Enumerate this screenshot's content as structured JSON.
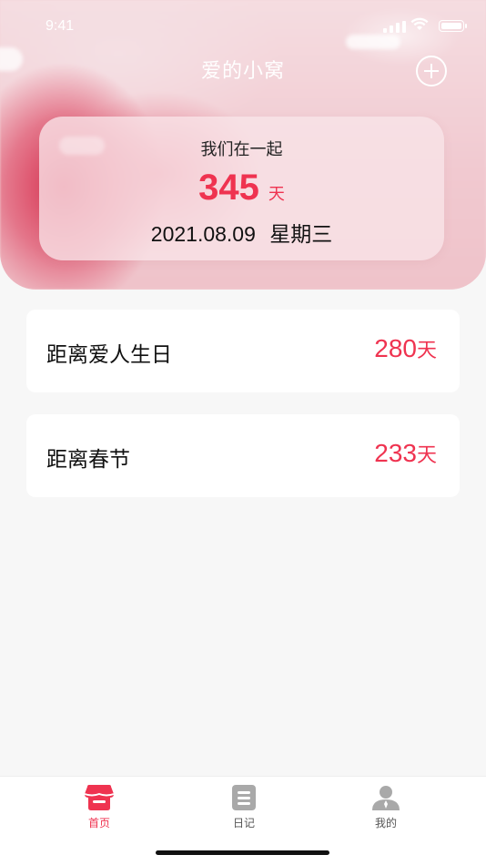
{
  "status_bar": {
    "time": "9:41"
  },
  "header": {
    "title": "爱的小窝",
    "add_icon": "plus-circle-icon"
  },
  "together": {
    "label": "我们在一起",
    "days": "345",
    "unit": "天",
    "date": "2021.08.09",
    "weekday": "星期三"
  },
  "countdowns": [
    {
      "label": "距离爱人生日",
      "value": "280",
      "unit": "天"
    },
    {
      "label": "距离春节",
      "value": "233",
      "unit": "天"
    }
  ],
  "tabbar": {
    "items": [
      {
        "label": "首页",
        "icon": "shop-home-icon",
        "active": true
      },
      {
        "label": "日记",
        "icon": "diary-list-icon",
        "active": false
      },
      {
        "label": "我的",
        "icon": "user-profile-icon",
        "active": false
      }
    ]
  },
  "colors": {
    "accent": "#ef3350",
    "hero_bg": "#f3d3d8",
    "page_bg": "#f7f7f7"
  }
}
